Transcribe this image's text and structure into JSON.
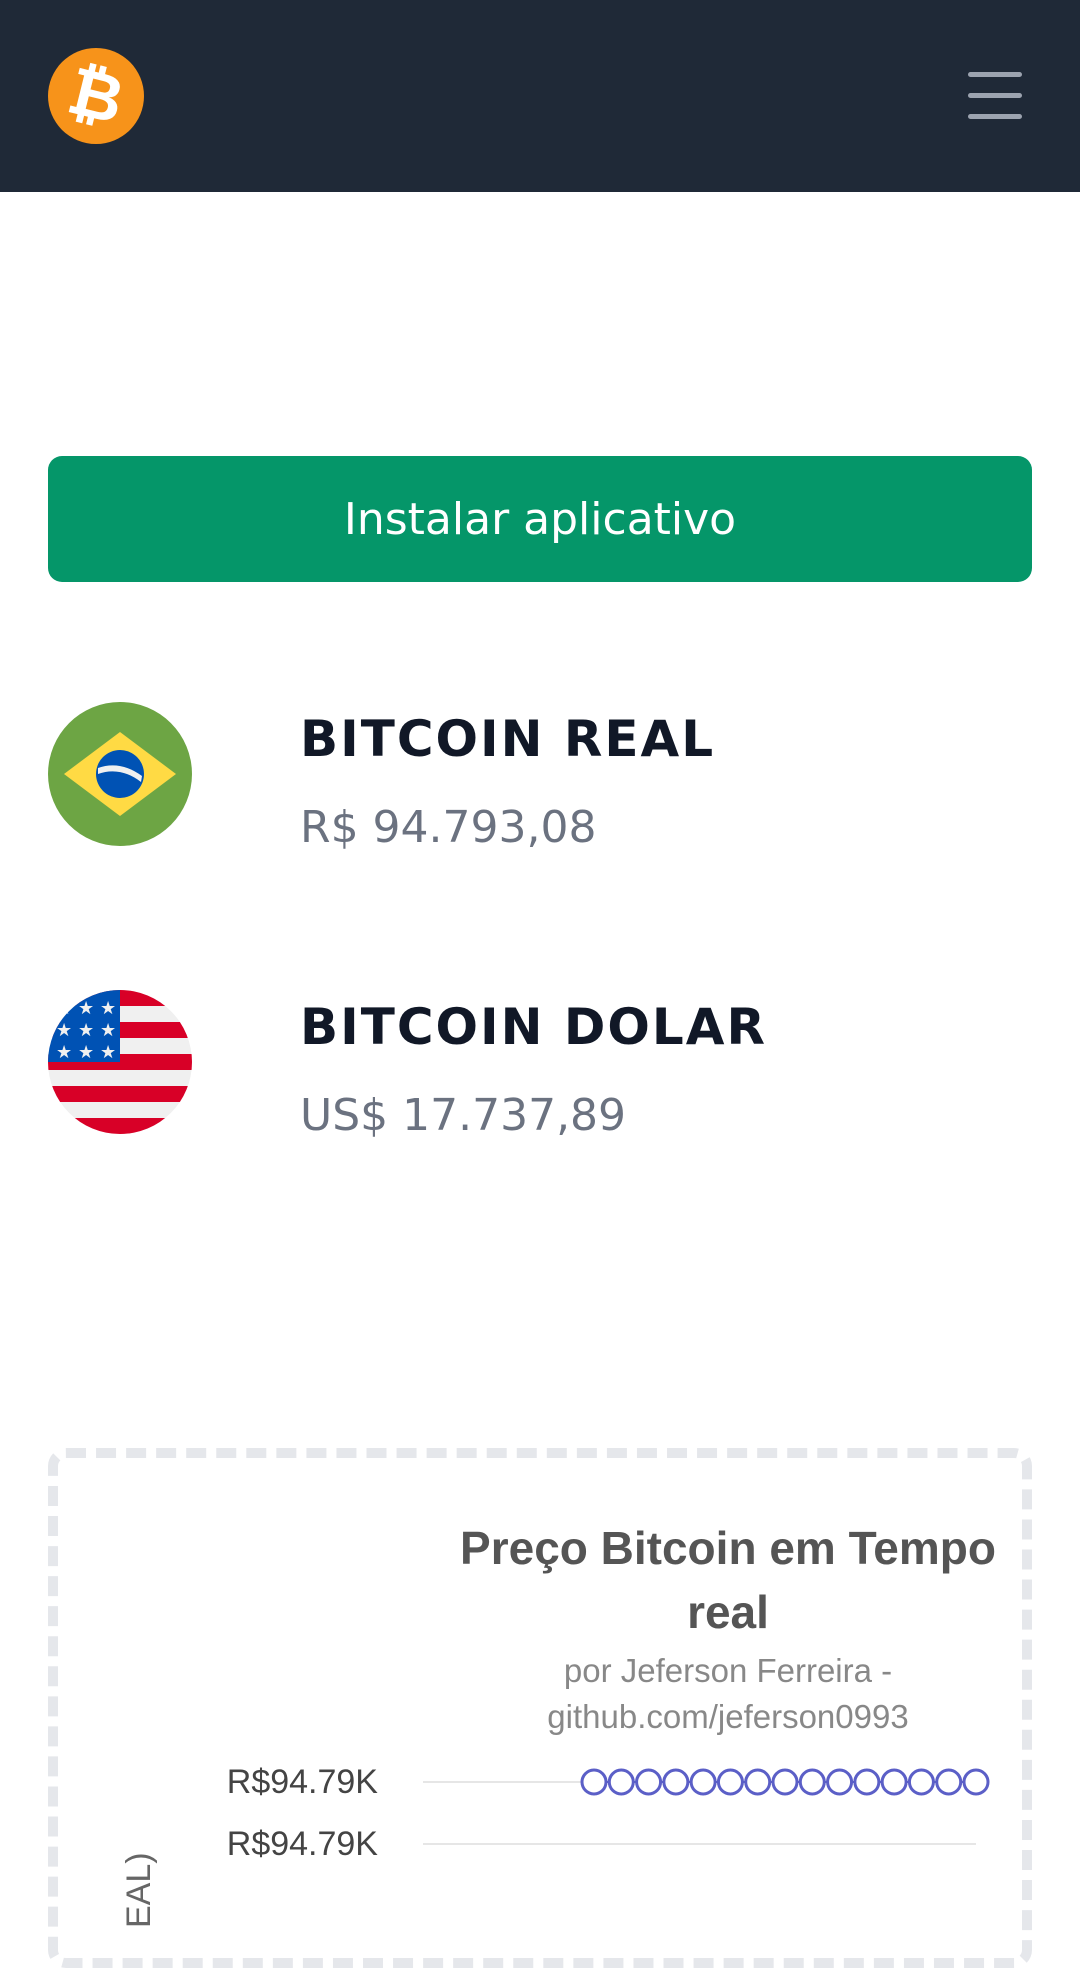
{
  "header": {
    "logo_glyph": "₿",
    "logo_icon": "bitcoin-logo-icon",
    "menu_icon": "hamburger-menu-icon",
    "background_color": "#1f2937",
    "logo_color": "#f7931a"
  },
  "install_button": {
    "label": "Instalar aplicativo",
    "color": "#059669"
  },
  "coins": [
    {
      "name": "BITCOIN REAL",
      "price": "R$ 94.793,08",
      "flag_icon": "brazil-flag-icon"
    },
    {
      "name": "BITCOIN DOLAR",
      "price": "US$ 17.737,89",
      "flag_icon": "usa-flag-icon"
    }
  ],
  "chart": {
    "title": "Preço Bitcoin em Tempo real",
    "subtitle": "por Jeferson Ferreira - github.com/jeferson0993",
    "y_axis_title_partial": "EAL)",
    "series_color": "#5b5fc7"
  },
  "chart_data": {
    "type": "line",
    "title": "Preço Bitcoin em Tempo real",
    "subtitle": "por Jeferson Ferreira - github.com/jeferson0993",
    "ylabel": "EAL)",
    "yticks": [
      "R$94.79K",
      "R$94.79K"
    ],
    "series": [
      {
        "values": [
          94793.08,
          94793.08,
          94793.08,
          94793.08,
          94793.08,
          94793.08,
          94793.08,
          94793.08,
          94793.08,
          94793.08,
          94793.08,
          94793.08,
          94793.08,
          94793.08,
          94793.08
        ]
      }
    ],
    "grid": true
  }
}
